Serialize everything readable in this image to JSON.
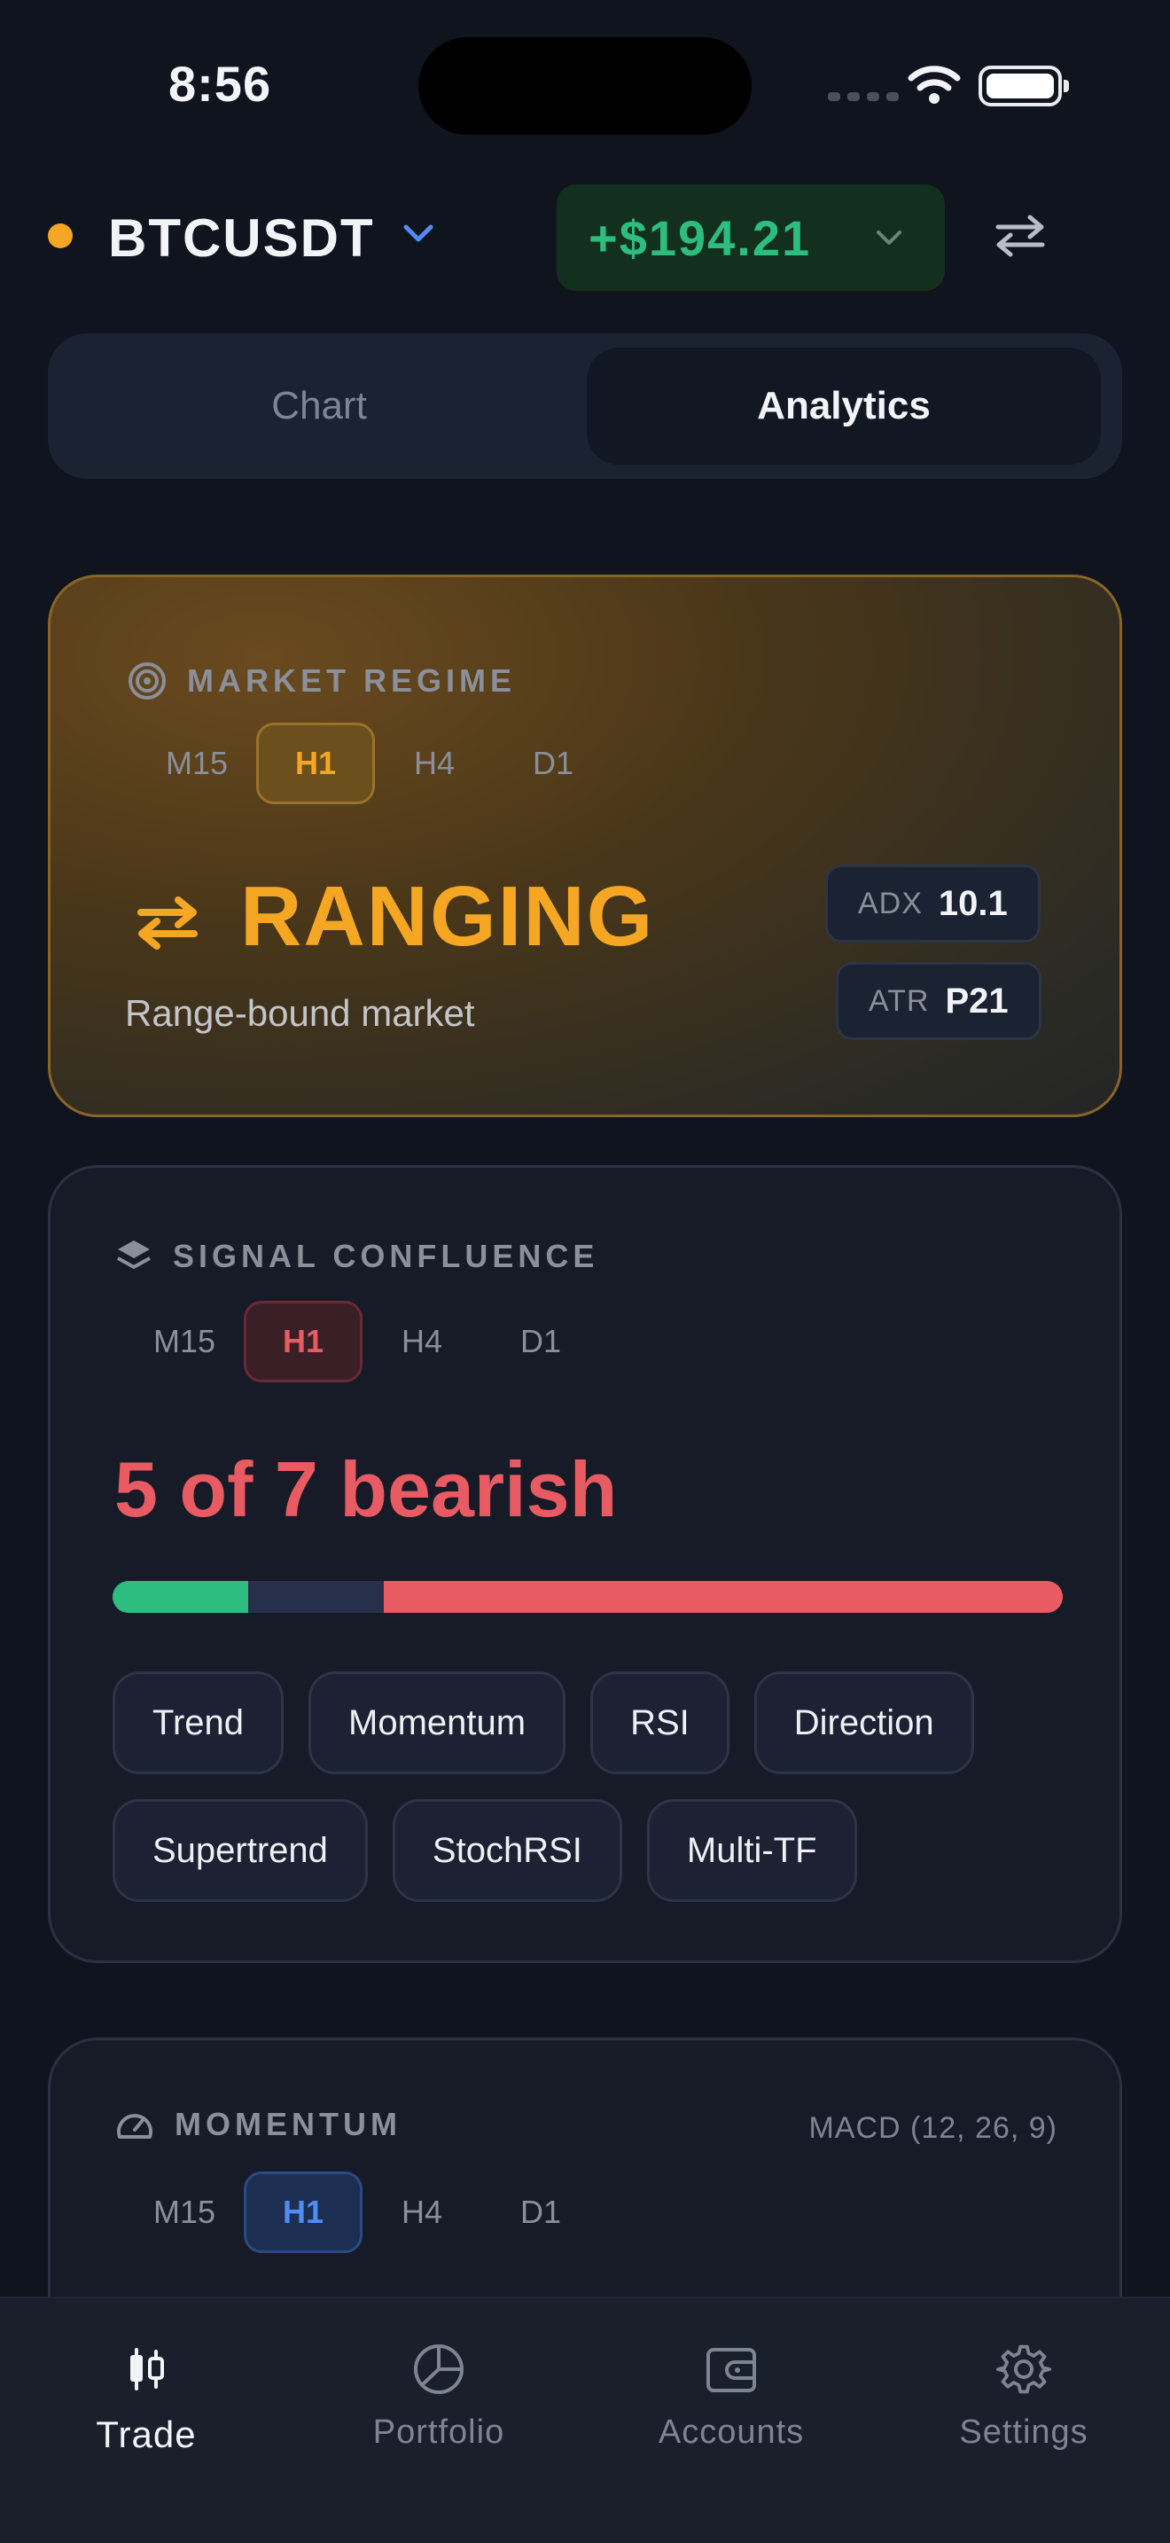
{
  "status_bar": {
    "time": "8:56"
  },
  "header": {
    "symbol": "BTCUSDT",
    "pnl": "+$194.21",
    "colors": {
      "live_dot": "#f5a623",
      "pnl": "#2dbd7e"
    }
  },
  "segment": {
    "tabs": [
      "Chart",
      "Analytics"
    ],
    "selected": "Analytics"
  },
  "market_regime": {
    "title": "MARKET REGIME",
    "timeframes": [
      "M15",
      "H1",
      "H4",
      "D1"
    ],
    "selected": "H1",
    "state": "RANGING",
    "description": "Range-bound market",
    "adx": {
      "label": "ADX",
      "value": "10.1"
    },
    "atr": {
      "label": "ATR",
      "value": "P21"
    },
    "accent": "#f5a623"
  },
  "signal_confluence": {
    "title": "SIGNAL CONFLUENCE",
    "timeframes": [
      "M15",
      "H1",
      "H4",
      "D1"
    ],
    "selected": "H1",
    "headline": "5 of 7 bearish",
    "bullish": 1,
    "neutral": 1,
    "bearish": 5,
    "total": 7,
    "colors": {
      "bullish": "#2dbd7e",
      "neutral": "#26304a",
      "bearish": "#e85b63"
    },
    "signals": [
      "Trend",
      "Momentum",
      "RSI",
      "Direction",
      "Supertrend",
      "StochRSI",
      "Multi-TF"
    ]
  },
  "momentum": {
    "title": "MOMENTUM",
    "indicator": "MACD (12, 26, 9)",
    "timeframes": [
      "M15",
      "H1",
      "H4",
      "D1"
    ],
    "selected": "H1"
  },
  "bottom_nav": {
    "items": [
      {
        "label": "Trade",
        "icon": "candlestick-icon",
        "active": true
      },
      {
        "label": "Portfolio",
        "icon": "pie-chart-icon",
        "active": false
      },
      {
        "label": "Accounts",
        "icon": "wallet-icon",
        "active": false
      },
      {
        "label": "Settings",
        "icon": "gear-icon",
        "active": false
      }
    ]
  }
}
